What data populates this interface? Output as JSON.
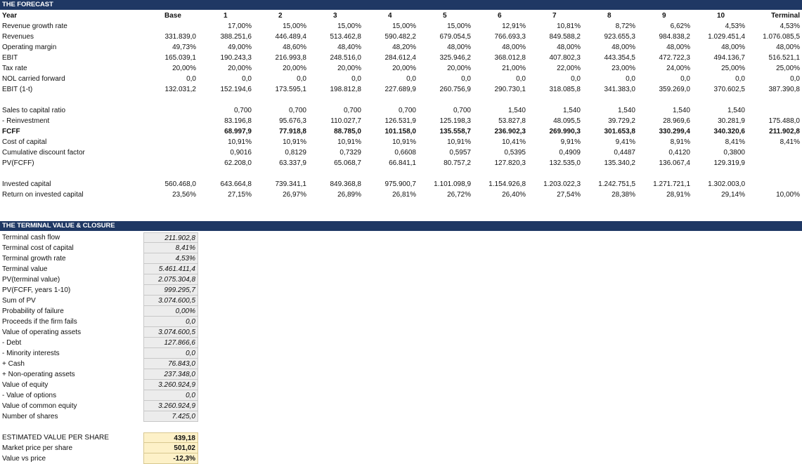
{
  "forecast": {
    "title": "THE FORECAST",
    "header": {
      "label": "Year",
      "cols": [
        "Base",
        "1",
        "2",
        "3",
        "4",
        "5",
        "6",
        "7",
        "8",
        "9",
        "10",
        "Terminal"
      ]
    },
    "rows": [
      {
        "label": "Revenue growth rate",
        "bold": false,
        "values": [
          "",
          "17,00%",
          "15,00%",
          "15,00%",
          "15,00%",
          "15,00%",
          "12,91%",
          "10,81%",
          "8,72%",
          "6,62%",
          "4,53%",
          "4,53%"
        ]
      },
      {
        "label": "Revenues",
        "bold": false,
        "values": [
          "331.839,0",
          "388.251,6",
          "446.489,4",
          "513.462,8",
          "590.482,2",
          "679.054,5",
          "766.693,3",
          "849.588,2",
          "923.655,3",
          "984.838,2",
          "1.029.451,4",
          "1.076.085,5"
        ]
      },
      {
        "label": "Operating margin",
        "bold": false,
        "values": [
          "49,73%",
          "49,00%",
          "48,60%",
          "48,40%",
          "48,20%",
          "48,00%",
          "48,00%",
          "48,00%",
          "48,00%",
          "48,00%",
          "48,00%",
          "48,00%"
        ]
      },
      {
        "label": "EBIT",
        "bold": false,
        "values": [
          "165.039,1",
          "190.243,3",
          "216.993,8",
          "248.516,0",
          "284.612,4",
          "325.946,2",
          "368.012,8",
          "407.802,3",
          "443.354,5",
          "472.722,3",
          "494.136,7",
          "516.521,1"
        ]
      },
      {
        "label": "Tax rate",
        "bold": false,
        "values": [
          "20,00%",
          "20,00%",
          "20,00%",
          "20,00%",
          "20,00%",
          "20,00%",
          "21,00%",
          "22,00%",
          "23,00%",
          "24,00%",
          "25,00%",
          "25,00%"
        ]
      },
      {
        "label": "NOL carried forward",
        "bold": false,
        "values": [
          "0,0",
          "0,0",
          "0,0",
          "0,0",
          "0,0",
          "0,0",
          "0,0",
          "0,0",
          "0,0",
          "0,0",
          "0,0",
          "0,0"
        ]
      },
      {
        "label": "EBIT (1-t)",
        "bold": false,
        "values": [
          "132.031,2",
          "152.194,6",
          "173.595,1",
          "198.812,8",
          "227.689,9",
          "260.756,9",
          "290.730,1",
          "318.085,8",
          "341.383,0",
          "359.269,0",
          "370.602,5",
          "387.390,8"
        ]
      },
      {
        "label": "",
        "bold": false,
        "values": [
          "",
          "",
          "",
          "",
          "",
          "",
          "",
          "",
          "",
          "",
          "",
          ""
        ]
      },
      {
        "label": "Sales to capital ratio",
        "bold": false,
        "values": [
          "",
          "0,700",
          "0,700",
          "0,700",
          "0,700",
          "0,700",
          "1,540",
          "1,540",
          "1,540",
          "1,540",
          "1,540",
          ""
        ]
      },
      {
        "label": "- Reinvestment",
        "bold": false,
        "values": [
          "",
          "83.196,8",
          "95.676,3",
          "110.027,7",
          "126.531,9",
          "125.198,3",
          "53.827,8",
          "48.095,5",
          "39.729,2",
          "28.969,6",
          "30.281,9",
          "175.488,0"
        ]
      },
      {
        "label": "FCFF",
        "bold": true,
        "values": [
          "",
          "68.997,9",
          "77.918,8",
          "88.785,0",
          "101.158,0",
          "135.558,7",
          "236.902,3",
          "269.990,3",
          "301.653,8",
          "330.299,4",
          "340.320,6",
          "211.902,8"
        ]
      },
      {
        "label": "Cost of capital",
        "bold": false,
        "values": [
          "",
          "10,91%",
          "10,91%",
          "10,91%",
          "10,91%",
          "10,91%",
          "10,41%",
          "9,91%",
          "9,41%",
          "8,91%",
          "8,41%",
          "8,41%"
        ]
      },
      {
        "label": "Cumulative discount factor",
        "bold": false,
        "values": [
          "",
          "0,9016",
          "0,8129",
          "0,7329",
          "0,6608",
          "0,5957",
          "0,5395",
          "0,4909",
          "0,4487",
          "0,4120",
          "0,3800",
          ""
        ]
      },
      {
        "label": "PV(FCFF)",
        "bold": false,
        "values": [
          "",
          "62.208,0",
          "63.337,9",
          "65.068,7",
          "66.841,1",
          "80.757,2",
          "127.820,3",
          "132.535,0",
          "135.340,2",
          "136.067,4",
          "129.319,9",
          ""
        ]
      },
      {
        "label": "",
        "bold": false,
        "values": [
          "",
          "",
          "",
          "",
          "",
          "",
          "",
          "",
          "",
          "",
          "",
          ""
        ]
      },
      {
        "label": "Invested capital",
        "bold": false,
        "values": [
          "560.468,0",
          "643.664,8",
          "739.341,1",
          "849.368,8",
          "975.900,7",
          "1.101.098,9",
          "1.154.926,8",
          "1.203.022,3",
          "1.242.751,5",
          "1.271.721,1",
          "1.302.003,0",
          ""
        ]
      },
      {
        "label": "Return on invested capital",
        "bold": false,
        "values": [
          "23,56%",
          "27,15%",
          "26,97%",
          "26,89%",
          "26,81%",
          "26,72%",
          "26,40%",
          "27,54%",
          "28,38%",
          "28,91%",
          "29,14%",
          "10,00%"
        ]
      }
    ]
  },
  "terminal": {
    "title": "THE TERMINAL VALUE & CLOSURE",
    "rows": [
      {
        "label": "Terminal cash flow",
        "value": "211.902,8"
      },
      {
        "label": "Terminal cost of capital",
        "value": "8,41%"
      },
      {
        "label": "Terminal growth rate",
        "value": "4,53%"
      },
      {
        "label": "Terminal value",
        "value": "5.461.411,4"
      },
      {
        "label": "PV(terminal value)",
        "value": "2.075.304,8"
      },
      {
        "label": "PV(FCFF, years 1-10)",
        "value": "999.295,7"
      },
      {
        "label": "Sum of PV",
        "value": "3.074.600,5"
      },
      {
        "label": "Probability of failure",
        "value": "0,00%"
      },
      {
        "label": "Proceeds if the firm fails",
        "value": "0,0"
      },
      {
        "label": "Value of operating assets",
        "value": "3.074.600,5"
      },
      {
        "label": "- Debt",
        "value": "127.866,6"
      },
      {
        "label": "- Minority interests",
        "value": "0,0"
      },
      {
        "label": "+ Cash",
        "value": "76.843,0"
      },
      {
        "label": "+ Non-operating assets",
        "value": "237.348,0"
      },
      {
        "label": "Value of equity",
        "value": "3.260.924,9"
      },
      {
        "label": "- Value of options",
        "value": "0,0"
      },
      {
        "label": "Value of common equity",
        "value": "3.260.924,9"
      },
      {
        "label": "Number of shares",
        "value": "7.425,0"
      }
    ]
  },
  "estimate": {
    "rows": [
      {
        "label": "ESTIMATED VALUE PER SHARE",
        "value": "439,18"
      },
      {
        "label": "Market price per share",
        "value": "501,02"
      },
      {
        "label": "Value vs price",
        "value": "-12,3%"
      }
    ]
  }
}
